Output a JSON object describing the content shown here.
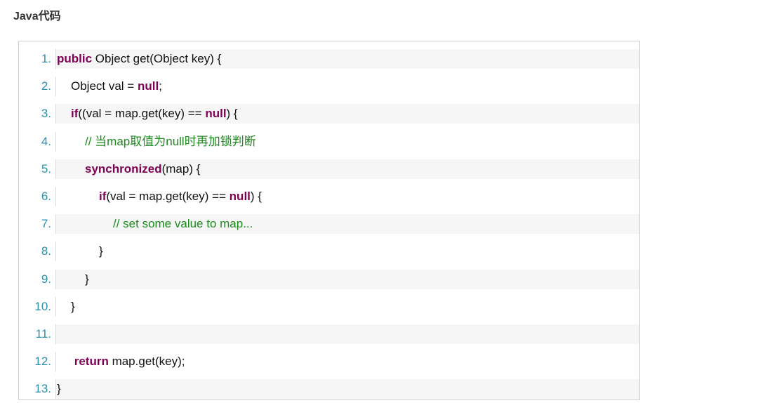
{
  "header": {
    "title": "Java代码"
  },
  "code": {
    "lines": [
      {
        "num": "1.",
        "indent": 0,
        "tokens": [
          {
            "t": "public",
            "k": "kw"
          },
          {
            "t": " Object get(Object key) {",
            "k": ""
          }
        ]
      },
      {
        "num": "2.",
        "indent": 1,
        "tokens": [
          {
            "t": "Object val = ",
            "k": ""
          },
          {
            "t": "null",
            "k": "kw"
          },
          {
            "t": ";",
            "k": ""
          }
        ]
      },
      {
        "num": "3.",
        "indent": 1,
        "tokens": [
          {
            "t": "if",
            "k": "kw"
          },
          {
            "t": "((val = map.get(key) == ",
            "k": ""
          },
          {
            "t": "null",
            "k": "kw"
          },
          {
            "t": ") {",
            "k": ""
          }
        ]
      },
      {
        "num": "4.",
        "indent": 2,
        "tokens": [
          {
            "t": "// 当map取值为null时再加锁判断",
            "k": "cm"
          }
        ]
      },
      {
        "num": "5.",
        "indent": 2,
        "tokens": [
          {
            "t": "synchronized",
            "k": "kw"
          },
          {
            "t": "(map) {",
            "k": ""
          }
        ]
      },
      {
        "num": "6.",
        "indent": 3,
        "tokens": [
          {
            "t": "if",
            "k": "kw"
          },
          {
            "t": "(val = map.get(key) == ",
            "k": ""
          },
          {
            "t": "null",
            "k": "kw"
          },
          {
            "t": ") {",
            "k": ""
          }
        ]
      },
      {
        "num": "7.",
        "indent": 4,
        "tokens": [
          {
            "t": "// set some value to map...",
            "k": "cm"
          }
        ]
      },
      {
        "num": "8.",
        "indent": 3,
        "tokens": [
          {
            "t": "}",
            "k": ""
          }
        ]
      },
      {
        "num": "9.",
        "indent": 2,
        "tokens": [
          {
            "t": "}",
            "k": ""
          }
        ]
      },
      {
        "num": "10.",
        "indent": 1,
        "tokens": [
          {
            "t": "}",
            "k": ""
          }
        ]
      },
      {
        "num": "11.",
        "indent": 0,
        "tokens": []
      },
      {
        "num": "12.",
        "indent": 1,
        "tokens": [
          {
            "t": " return",
            "k": "kw"
          },
          {
            "t": " map.get(key);",
            "k": ""
          }
        ]
      },
      {
        "num": "13.",
        "indent": 0,
        "tokens": [
          {
            "t": "}",
            "k": ""
          }
        ]
      }
    ]
  }
}
